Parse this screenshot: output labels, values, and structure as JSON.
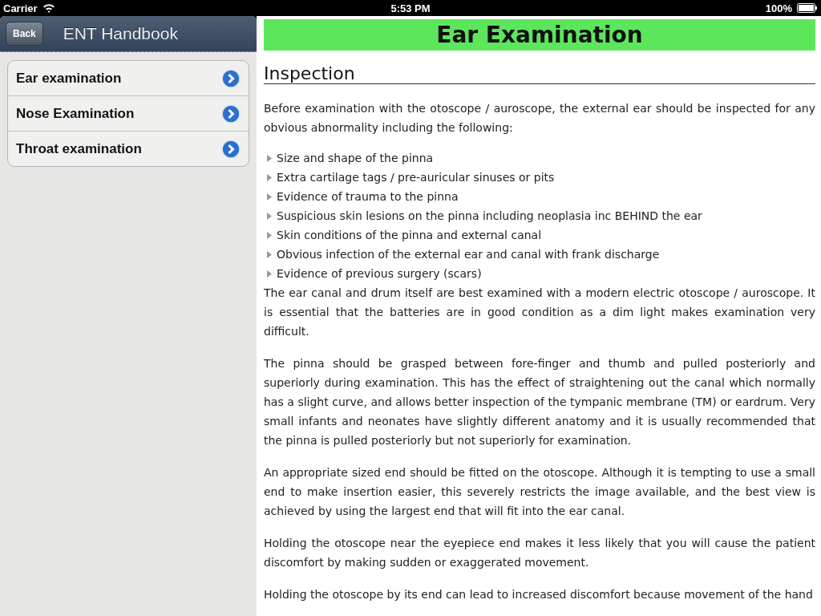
{
  "status_bar": {
    "carrier": "Carrier",
    "time": "5:53 PM",
    "battery": "100%"
  },
  "sidebar": {
    "back": "Back",
    "title": "ENT Handbook",
    "items": [
      {
        "label": "Ear examination"
      },
      {
        "label": "Nose Examination"
      },
      {
        "label": "Throat examination"
      }
    ]
  },
  "content": {
    "title": "Ear Examination",
    "heading": "Inspection",
    "intro": "Before examination with the otoscope / auroscope, the external ear should be inspected for any obvious abnormality including the following:",
    "bullets": [
      "Size and shape of the pinna",
      "Extra cartilage tags / pre-auricular sinuses or pits",
      "Evidence of trauma to the pinna",
      "Suspicious skin lesions on the pinna including neoplasia inc BEHIND the ear",
      "Skin conditions of the pinna and external canal",
      "Obvious infection of the external ear and canal with frank discharge",
      "Evidence of previous surgery (scars)"
    ],
    "paragraphs": [
      "The ear canal and drum itself are best examined with a modern electric otoscope / auroscope. It is essential that the batteries are in good condition as a dim light makes examination very difficult.",
      "The pinna should be grasped between fore-finger and thumb and pulled posteriorly and superiorly during examination. This has the effect of straightening out the canal which normally has a slight curve, and allows better inspection of the tympanic membrane (TM) or eardrum. Very small infants and neonates have slightly different anatomy and it is usually recommended that the pinna is pulled posteriorly but not superiorly for examination.",
      "An appropriate sized end should be fitted on the otoscope. Although it is tempting to use a small end to make insertion easier, this severely restricts the image available, and the best view is achieved by using the largest end that will fit into the ear canal.",
      "Holding the otoscope near the eyepiece end makes it less likely that you will cause the patient discomfort by making sudden or exaggerated movement.",
      "Holding the otoscope by its end can lead to increased discomfort because movement of the hand"
    ]
  }
}
